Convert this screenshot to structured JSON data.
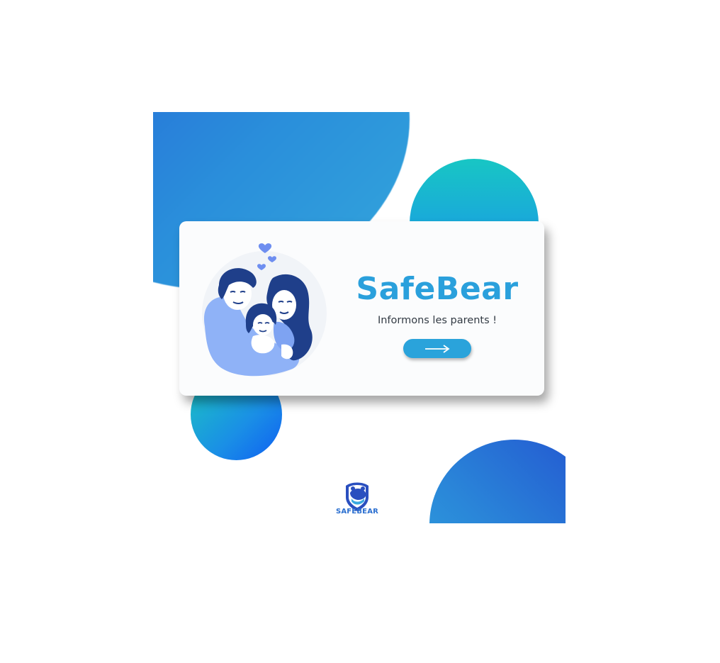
{
  "card": {
    "title": "SafeBear",
    "tagline": "Informons les parents !",
    "next_button_icon": "arrow-right-icon"
  },
  "logo": {
    "text": "SAFEBEAR",
    "icon": "bear-shield-icon"
  },
  "illustration": {
    "icon": "family-hug-illustration"
  },
  "colors": {
    "accent": "#2aa0dc",
    "brand_dark": "#1f3f8a",
    "teal": "#18c6c4",
    "deep_blue": "#2559d6",
    "text": "#333b44"
  }
}
